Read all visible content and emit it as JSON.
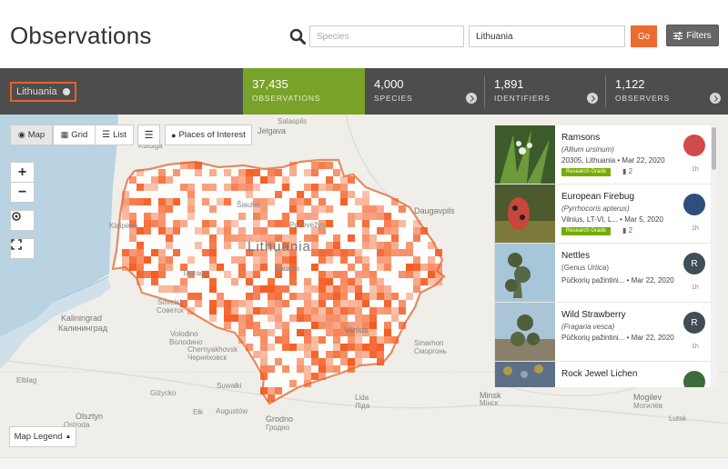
{
  "header": {
    "title": "Observations",
    "species_placeholder": "Species",
    "place_value": "Lithuania",
    "go_label": "Go",
    "filters_label": "Filters"
  },
  "stats": {
    "place_chip": "Lithuania",
    "observations": {
      "num": "37,435",
      "label": "OBSERVATIONS"
    },
    "species": {
      "num": "4,000",
      "label": "SPECIES"
    },
    "identifiers": {
      "num": "1,891",
      "label": "IDENTIFIERS"
    },
    "observers": {
      "num": "1,122",
      "label": "OBSERVERS"
    }
  },
  "map_toolbar": {
    "map": "Map",
    "grid": "Grid",
    "list": "List",
    "places": "Places of Interest",
    "legend": "Map Legend"
  },
  "map_labels": [
    "Salaspils",
    "Jelgava",
    "Kuldiga",
    "Daugavpils",
    "Lithuania",
    "Šiauliai",
    "Panevėžys",
    "Klaipėda",
    "Kaunas",
    "Vilnius",
    "Tauragė",
    "Sovetsk",
    "Советск",
    "Kaliningrad",
    "Калининград",
    "Volodino",
    "Волоdино",
    "Chernyakhovsk",
    "Черняховск",
    "Smarhon",
    "Сморгонь",
    "Minsk",
    "Мінск",
    "Elblag",
    "Olsztyn",
    "Giżycko",
    "Ełk",
    "Suwałki",
    "Augustów",
    "Grodno",
    "Гродно",
    "Lida",
    "Ліда",
    "Mogilev",
    "Могилёв",
    "Lutsk",
    "Ostroda"
  ],
  "observations": [
    {
      "name": "Ramsons",
      "sci_prefix": "(",
      "sci": "Allium ursinum",
      "sci_suffix": ")",
      "meta": "20305, Lithuania • Mar 22, 2020",
      "badge": "Research Grade",
      "ids": "2",
      "time": "1h",
      "avatar": ""
    },
    {
      "name": "European Firebug",
      "sci_prefix": "(",
      "sci": "Pyrrhocoris apterus",
      "sci_suffix": ")",
      "meta": "Vilnius, LT-VI, L... • Mar 5, 2020",
      "badge": "Research Grade",
      "ids": "2",
      "time": "1h",
      "avatar": ""
    },
    {
      "name": "Nettles",
      "sci_prefix": "(Genus ",
      "sci": "Urtica",
      "sci_suffix": ")",
      "meta": "Pūčkorių pažintini... • Mar 22, 2020",
      "badge": "",
      "ids": "",
      "time": "1h",
      "avatar": "R"
    },
    {
      "name": "Wild Strawberry",
      "sci_prefix": "(",
      "sci": "Fragaria vesca",
      "sci_suffix": ")",
      "meta": "Pūčkorių pažintini... • Mar 22, 2020",
      "badge": "",
      "ids": "",
      "time": "1h",
      "avatar": "R"
    },
    {
      "name": "Rock Jewel Lichen",
      "sci_prefix": "",
      "sci": "",
      "sci_suffix": "",
      "meta": "",
      "badge": "",
      "ids": "",
      "time": "",
      "avatar": ""
    }
  ],
  "colors": {
    "accent": "#ec6b2f",
    "green": "#78a228",
    "grid": "#f45a1f"
  }
}
